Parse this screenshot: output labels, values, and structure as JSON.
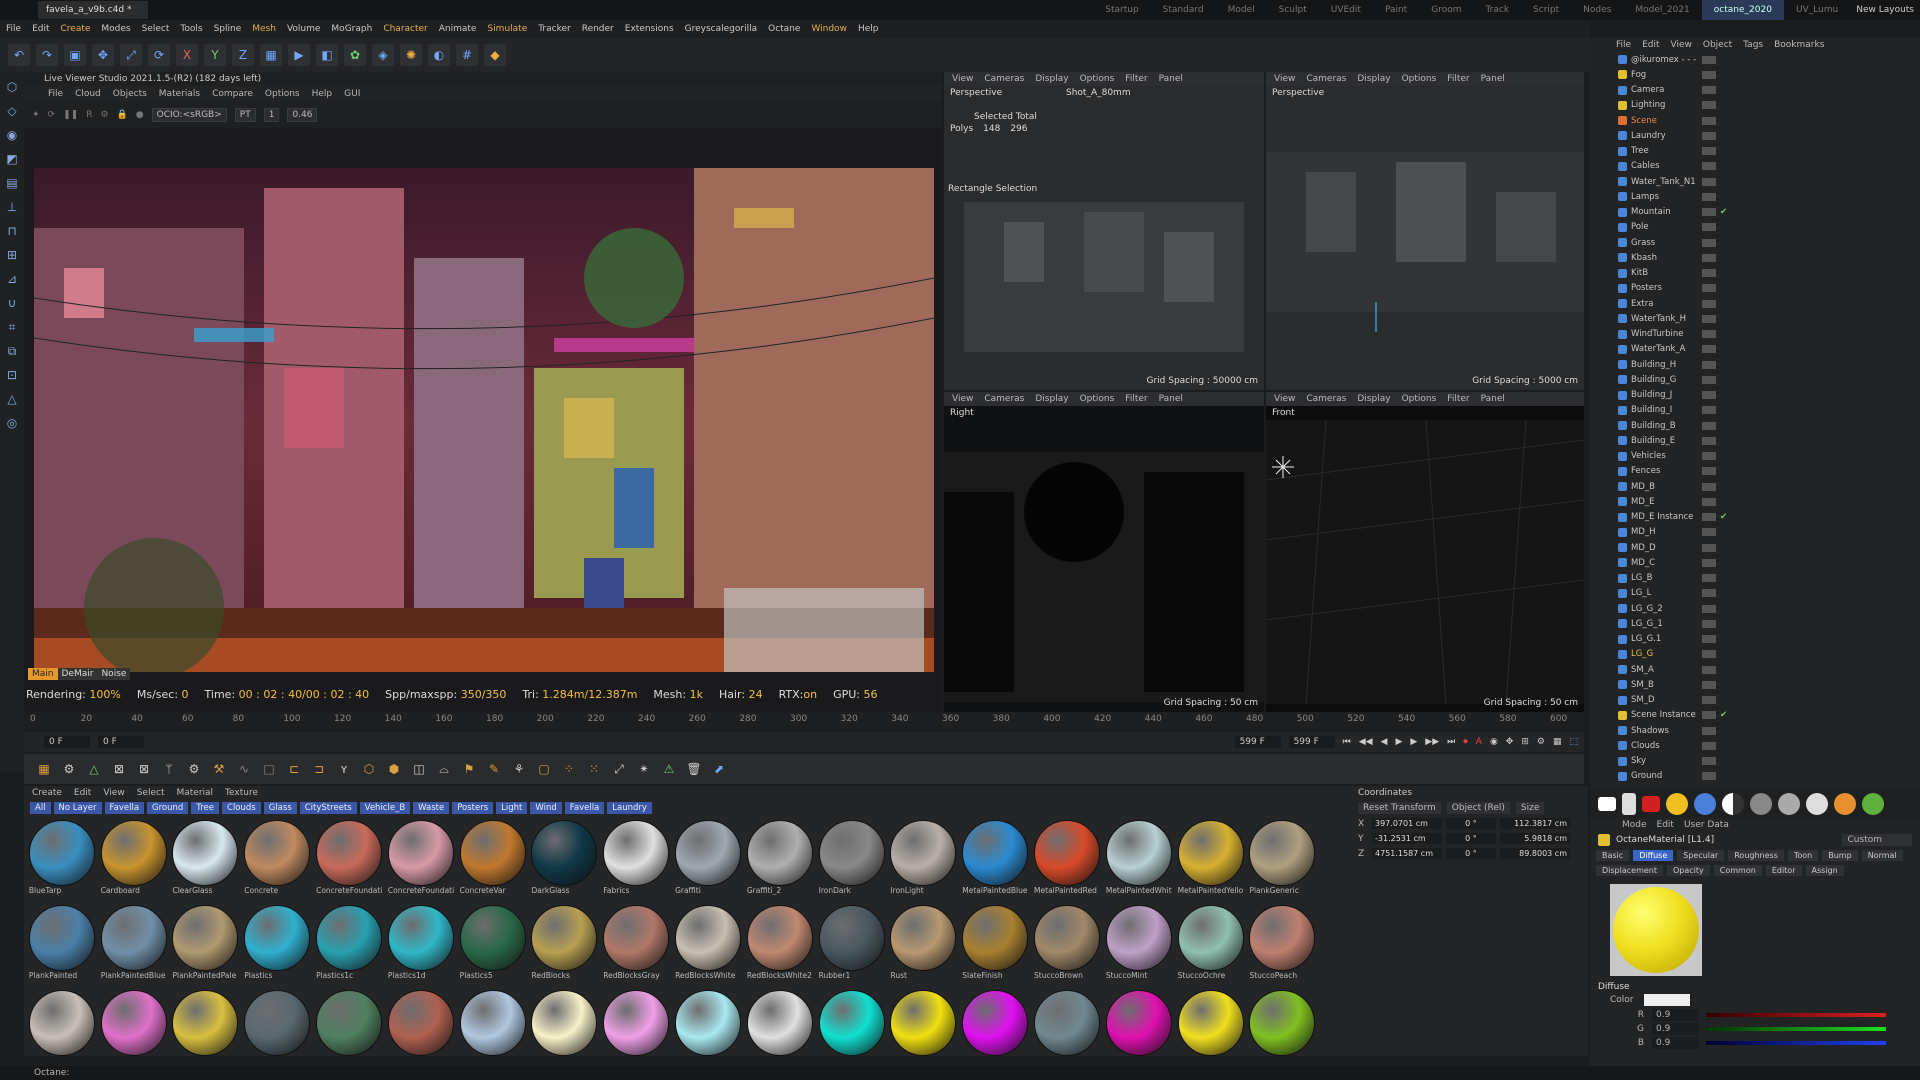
{
  "titlebar": {
    "file_tab": "favela_a_v9b.c4d *",
    "layouts": [
      "Startup",
      "Standard",
      "Model",
      "Sculpt",
      "UVEdit",
      "Paint",
      "Groom",
      "Track",
      "Script",
      "Nodes",
      "Model_2021",
      "octane_2020",
      "UV_Lumu"
    ],
    "active_layout": "octane_2020",
    "new_layouts": "New Layouts"
  },
  "menubar": [
    "File",
    "Edit",
    "Create",
    "Modes",
    "Select",
    "Tools",
    "Spline",
    "Mesh",
    "Volume",
    "MoGraph",
    "Character",
    "Animate",
    "Simulate",
    "Tracker",
    "Render",
    "Extensions",
    "Greyscalegorilla",
    "Octane",
    "Window",
    "Help"
  ],
  "live_viewer": {
    "title": "Live Viewer Studio 2021.1.5-(R2) (182 days left)",
    "menu": [
      "File",
      "Cloud",
      "Objects",
      "Materials",
      "Compare",
      "Options",
      "Help",
      "GUI"
    ],
    "ocio": "OCIO:<sRGB>",
    "pt": "PT",
    "val1": "1",
    "val2": "0.46",
    "tabs": [
      "Main",
      "DeMair",
      "Noise"
    ],
    "stats": {
      "rendering_label": "Rendering:",
      "rendering": "100%",
      "ms_label": "Ms/sec:",
      "ms": "0",
      "time_label": "Time:",
      "time": "00 : 02 : 40/00 : 02 : 40",
      "spp_label": "Spp/maxspp:",
      "spp": "350/350",
      "tri_label": "Tri:",
      "tri": "1.284m/12.387m",
      "mesh_label": "Mesh:",
      "mesh": "1k",
      "hair_label": "Hair:",
      "hair": "24",
      "rtx_label": "RTX:",
      "rtx": "on",
      "gpu_label": "GPU:",
      "gpu": "56"
    }
  },
  "viewports": {
    "menu": [
      "View",
      "Cameras",
      "Display",
      "Options",
      "Filter",
      "Panel"
    ],
    "tl": {
      "name": "Perspective",
      "camera": "Shot_A_80mm",
      "sel_title": "Selected Total",
      "polys_label": "Polys",
      "polys_sel": "148",
      "polys_total": "296",
      "rect_sel": "Rectangle Selection",
      "grid": "Grid Spacing : 50000 cm"
    },
    "tr": {
      "name": "Perspective",
      "grid": "Grid Spacing : 5000 cm"
    },
    "bl": {
      "name": "Right",
      "grid": "Grid Spacing : 50 cm"
    },
    "br": {
      "name": "Front",
      "grid": "Grid Spacing : 50 cm"
    }
  },
  "timeline": {
    "ticks": [
      "0",
      "20",
      "40",
      "60",
      "80",
      "100",
      "120",
      "140",
      "160",
      "180",
      "200",
      "220",
      "240",
      "260",
      "280",
      "300",
      "320",
      "340",
      "360",
      "380",
      "400",
      "420",
      "440",
      "460",
      "480",
      "500",
      "520",
      "540",
      "560",
      "580",
      "600"
    ],
    "start": "0 F",
    "current": "0 F",
    "end1": "599 F",
    "end2": "599 F"
  },
  "material_manager": {
    "menu": [
      "Create",
      "Edit",
      "View",
      "Select",
      "Material",
      "Texture"
    ],
    "layers": [
      "All",
      "No Layer",
      "Favella",
      "Ground",
      "Tree",
      "Clouds",
      "Glass",
      "CityStreets",
      "Vehicle_B",
      "Waste",
      "Posters",
      "Light",
      "Wind",
      "Favella",
      "Laundry"
    ],
    "materials": [
      {
        "name": "BlueTarp",
        "color": "#3a8fc0"
      },
      {
        "name": "Cardboard",
        "color": "#c8942e"
      },
      {
        "name": "ClearGlass",
        "color": "#d8e8f0"
      },
      {
        "name": "Concrete",
        "color": "#c08a60"
      },
      {
        "name": "ConcreteFoundati",
        "color": "#c86a5a"
      },
      {
        "name": "ConcreteFoundati",
        "color": "#d89aa8"
      },
      {
        "name": "ConcreteVar",
        "color": "#c0782e"
      },
      {
        "name": "DarkGlass",
        "color": "#103848"
      },
      {
        "name": "Fabrics",
        "color": "#e0e0e0"
      },
      {
        "name": "Graffiti",
        "color": "#a0a8b0"
      },
      {
        "name": "Graffiti_2",
        "color": "#b0b0b0"
      },
      {
        "name": "IronDark",
        "color": "#8a8888"
      },
      {
        "name": "IronLight",
        "color": "#b8b0a8"
      },
      {
        "name": "MetalPaintedBlue",
        "color": "#2a8ad0"
      },
      {
        "name": "MetalPaintedRed",
        "color": "#d84a2a"
      },
      {
        "name": "MetalPaintedWhit",
        "color": "#b8d0d0"
      },
      {
        "name": "MetalPaintedYello",
        "color": "#d8b030"
      },
      {
        "name": "PlankGeneric",
        "color": "#b0a080"
      },
      {
        "name": "PlankPainted",
        "color": "#4a80a8"
      },
      {
        "name": "PlankPaintedBlue",
        "color": "#7090a8"
      },
      {
        "name": "PlankPaintedPale",
        "color": "#b09a70"
      },
      {
        "name": "Plastics",
        "color": "#30b0d0"
      },
      {
        "name": "Plastics1c",
        "color": "#28a0b0"
      },
      {
        "name": "Plastics1d",
        "color": "#30b8c8"
      },
      {
        "name": "Plastics5",
        "color": "#286848"
      },
      {
        "name": "RedBlocks",
        "color": "#b8a050"
      },
      {
        "name": "RedBlocksGray",
        "color": "#b07868"
      },
      {
        "name": "RedBlocksWhite",
        "color": "#c8c0b0"
      },
      {
        "name": "RedBlocksWhite2",
        "color": "#c08870"
      },
      {
        "name": "Rubber1",
        "color": "#485860"
      },
      {
        "name": "Rust",
        "color": "#b89870"
      },
      {
        "name": "SlateFinish",
        "color": "#a88030"
      },
      {
        "name": "StuccoBrown",
        "color": "#a08868"
      },
      {
        "name": "StuccoMint",
        "color": "#c0a0c8"
      },
      {
        "name": "StuccoOchre",
        "color": "#90c0b0"
      },
      {
        "name": "StuccoPeach",
        "color": "#c08070"
      },
      {
        "name": "",
        "color": "#c8c0b8"
      },
      {
        "name": "",
        "color": "#e070c8"
      },
      {
        "name": "",
        "color": "#d8c040"
      },
      {
        "name": "",
        "color": "#586870"
      },
      {
        "name": "",
        "color": "#508060"
      },
      {
        "name": "",
        "color": "#b06050"
      },
      {
        "name": "",
        "color": "#b0c8e0"
      },
      {
        "name": "",
        "color": "#f8f0c8"
      },
      {
        "name": "",
        "color": "#f0a0e8"
      },
      {
        "name": "",
        "color": "#a8e8f0"
      },
      {
        "name": "",
        "color": "#e0e0e0"
      },
      {
        "name": "",
        "color": "#10e0d0"
      },
      {
        "name": "",
        "color": "#f0e010"
      },
      {
        "name": "",
        "color": "#e010f0"
      },
      {
        "name": "",
        "color": "#708890"
      },
      {
        "name": "",
        "color": "#e010b0"
      },
      {
        "name": "",
        "color": "#f0e020"
      },
      {
        "name": "",
        "color": "#80c020"
      }
    ]
  },
  "coordinates": {
    "title": "Coordinates",
    "reset": "Reset Transform",
    "mode": "Object (Rel)",
    "size": "Size",
    "rows": [
      {
        "axis": "X",
        "pos": "397.0701 cm",
        "rot": "0 °",
        "size": "112.3817 cm"
      },
      {
        "axis": "Y",
        "pos": "-31.2531 cm",
        "rot": "0 °",
        "size": "5.9818 cm"
      },
      {
        "axis": "Z",
        "pos": "4751.1587 cm",
        "rot": "0 °",
        "size": "89.8003 cm"
      }
    ]
  },
  "object_manager": {
    "menu": [
      "File",
      "Edit",
      "View",
      "Object",
      "Tags",
      "Bookmarks"
    ],
    "objects": [
      "@ikuromex - - -",
      "Fog",
      "Camera",
      "Lighting",
      "Scene",
      "Laundry",
      "Tree",
      "Cables",
      "Water_Tank_N1",
      "Lamps",
      "Mountain",
      "Pole",
      "Grass",
      "Kbash",
      "KitB",
      "Posters",
      "Extra",
      "WaterTank_H",
      "WindTurbine",
      "WaterTank_A",
      "Building_H",
      "Building_G",
      "Building_J",
      "Building_I",
      "Building_B",
      "Building_E",
      "Vehicles",
      "Fences",
      "MD_B",
      "MD_E",
      "MD_E Instance",
      "MD_H",
      "MD_D",
      "MD_C",
      "LG_B",
      "LG_L",
      "LG_G_2",
      "LG_G_1",
      "LG_G.1",
      "LG_G",
      "SM_A",
      "SM_B",
      "SM_D",
      "Scene Instance",
      "Shadows",
      "Clouds",
      "Sky",
      "Ground"
    ]
  },
  "attributes": {
    "menu": [
      "Mode",
      "Edit",
      "User Data"
    ],
    "material": "OctaneMaterial [L1.4]",
    "custom": "Custom",
    "tabs": [
      "Basic",
      "Diffuse",
      "Specular",
      "Roughness",
      "Toon",
      "Bump",
      "Normal",
      "Displacement",
      "Opacity",
      "Common",
      "Editor",
      "Assign"
    ],
    "active_tab": "Diffuse",
    "section": "Diffuse",
    "color_label": "Color",
    "r_label": "R",
    "r": "0.9",
    "g_label": "G",
    "g": "0.9",
    "b_label": "B",
    "b": "0.9",
    "preview_color": "#f0e020"
  },
  "statusbar": "Octane:"
}
